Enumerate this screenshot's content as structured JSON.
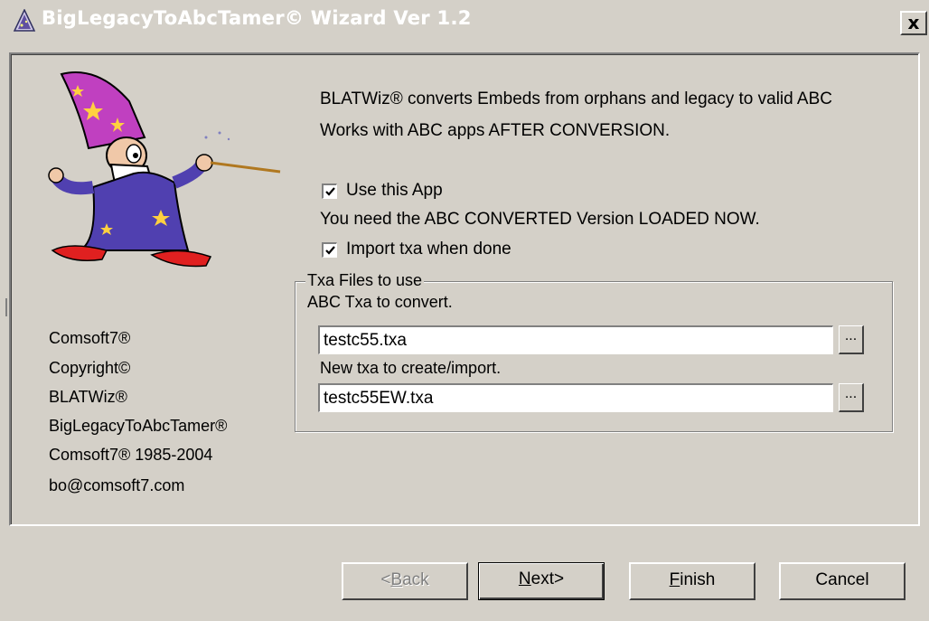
{
  "window": {
    "title": "BigLegacyToAbcTamer© Wizard  Ver 1.2",
    "close_label": "x"
  },
  "description": {
    "line1": "BLATWiz® converts Embeds from orphans and legacy to valid ABC",
    "line2": "Works with ABC apps AFTER CONVERSION."
  },
  "options": {
    "use_app": {
      "label": "Use this App",
      "checked": true
    },
    "note": "You need the ABC CONVERTED Version LOADED NOW.",
    "import_txa": {
      "label": "Import txa when done",
      "checked": true
    }
  },
  "files_group": {
    "title": "Txa Files to use",
    "convert_label": "ABC Txa to convert.",
    "convert_value": "testc55.txa",
    "create_label": "New txa to create/import.",
    "create_value": "testc55EW.txa",
    "browse_label": "..."
  },
  "info": {
    "lines": [
      "Comsoft7®",
      "Copyright©",
      "BLATWiz®",
      "BigLegacyToAbcTamer®",
      "Comsoft7® 1985-2004",
      "bo@comsoft7.com"
    ]
  },
  "buttons": {
    "back": {
      "prefix": "<",
      "accel": "B",
      "rest": "ack",
      "enabled": false
    },
    "next": {
      "accel": "N",
      "rest": "ext>"
    },
    "finish": {
      "accel": "F",
      "rest": "inish"
    },
    "cancel": "Cancel"
  },
  "colors": {
    "face": "#d4d0c8",
    "shadow": "#808080",
    "wizard_hat": "#c040c0",
    "wizard_robe": "#5040b0",
    "wizard_shoes": "#e02020"
  },
  "icons": {
    "app": "wizard-hat-icon",
    "close": "close-icon",
    "check": "check-icon"
  }
}
